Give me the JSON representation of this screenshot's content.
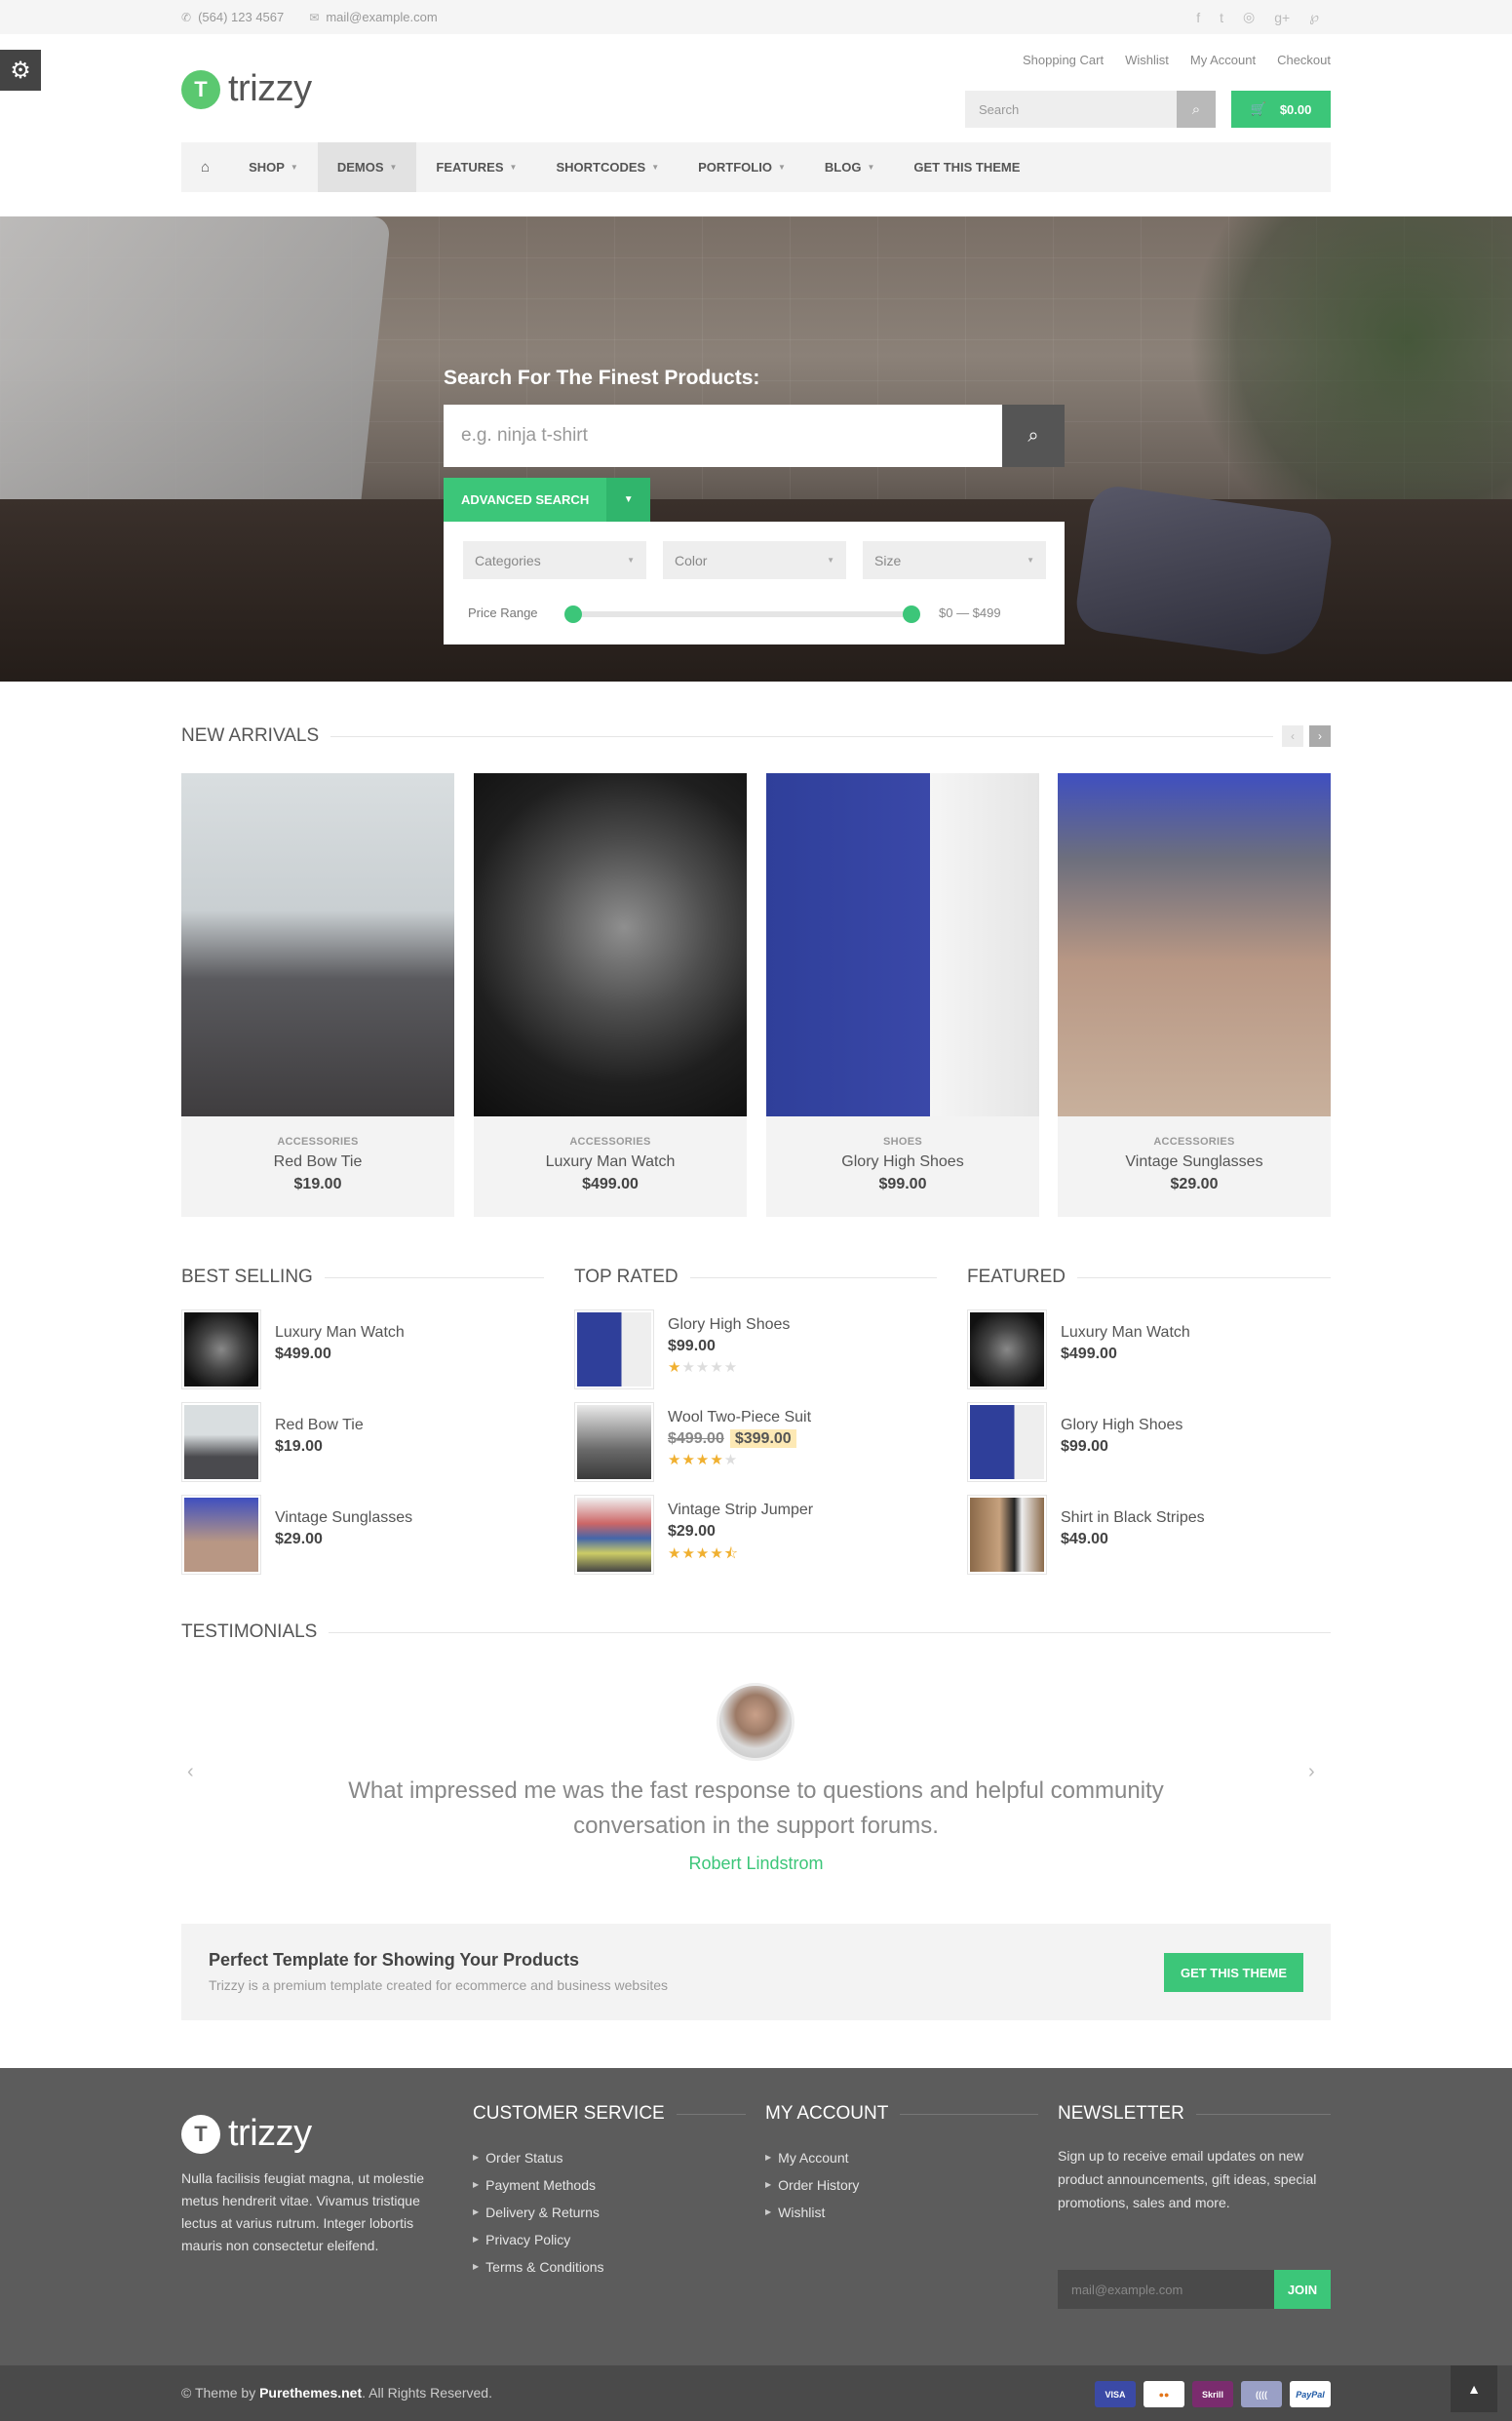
{
  "topbar": {
    "phone": "(564) 123 4567",
    "email": "mail@example.com",
    "social": [
      "facebook-icon",
      "twitter-icon",
      "dribbble-icon",
      "google-plus-icon",
      "pinterest-icon"
    ]
  },
  "header": {
    "logo_letter": "T",
    "logo_text": "trizzy",
    "links": [
      "Shopping Cart",
      "Wishlist",
      "My Account",
      "Checkout"
    ],
    "search_placeholder": "Search",
    "cart_total": "$0.00"
  },
  "nav": {
    "items": [
      {
        "label": "SHOP",
        "dropdown": true
      },
      {
        "label": "DEMOS",
        "dropdown": true,
        "active": true
      },
      {
        "label": "FEATURES",
        "dropdown": true
      },
      {
        "label": "SHORTCODES",
        "dropdown": true
      },
      {
        "label": "PORTFOLIO",
        "dropdown": true
      },
      {
        "label": "BLOG",
        "dropdown": true
      },
      {
        "label": "GET THIS THEME",
        "dropdown": false
      }
    ]
  },
  "hero": {
    "title": "Search For The Finest Products:",
    "search_placeholder": "e.g. ninja t-shirt",
    "advanced_label": "ADVANCED SEARCH",
    "filters": [
      "Categories",
      "Color",
      "Size"
    ],
    "price_label": "Price Range",
    "price_value": "$0 — $499",
    "price_min_fraction": 0,
    "price_max_fraction": 1
  },
  "new_arrivals": {
    "title": "NEW ARRIVALS",
    "products": [
      {
        "category": "ACCESSORIES",
        "name": "Red Bow Tie",
        "price": "$19.00",
        "image": "tie"
      },
      {
        "category": "ACCESSORIES",
        "name": "Luxury Man Watch",
        "price": "$499.00",
        "image": "watch"
      },
      {
        "category": "SHOES",
        "name": "Glory High Shoes",
        "price": "$99.00",
        "image": "shoes"
      },
      {
        "category": "ACCESSORIES",
        "name": "Vintage Sunglasses",
        "price": "$29.00",
        "image": "glasses"
      }
    ]
  },
  "best_selling": {
    "title": "BEST SELLING",
    "items": [
      {
        "name": "Luxury Man Watch",
        "price": "$499.00",
        "thumb": "watch"
      },
      {
        "name": "Red Bow Tie",
        "price": "$19.00",
        "thumb": "tie"
      },
      {
        "name": "Vintage Sunglasses",
        "price": "$29.00",
        "thumb": "glasses"
      }
    ]
  },
  "top_rated": {
    "title": "TOP RATED",
    "items": [
      {
        "name": "Glory High Shoes",
        "price": "$99.00",
        "rating": 1,
        "thumb": "shoes"
      },
      {
        "name": "Wool Two-Piece Suit",
        "old_price": "$499.00",
        "price": "$399.00",
        "rating": 4,
        "thumb": "suit"
      },
      {
        "name": "Vintage Strip Jumper",
        "price": "$29.00",
        "rating": 4.5,
        "thumb": "jumper"
      }
    ]
  },
  "featured": {
    "title": "FEATURED",
    "items": [
      {
        "name": "Luxury Man Watch",
        "price": "$499.00",
        "thumb": "watch"
      },
      {
        "name": "Glory High Shoes",
        "price": "$99.00",
        "thumb": "shoes"
      },
      {
        "name": "Shirt in Black Stripes",
        "price": "$49.00",
        "thumb": "stripes"
      }
    ]
  },
  "testimonials": {
    "title": "TESTIMONIALS",
    "quote": "What impressed me was the fast response to questions and helpful community conversation in the support forums.",
    "author": "Robert Lindstrom"
  },
  "cta": {
    "title": "Perfect Template for Showing Your Products",
    "text": "Trizzy is a premium template created for ecommerce and business websites",
    "button": "GET THIS THEME"
  },
  "footer": {
    "logo_text": "trizzy",
    "about": "Nulla facilisis feugiat magna, ut molestie metus hendrerit vitae. Vivamus tristique lectus at varius rutrum. Integer lobortis mauris non consectetur eleifend.",
    "customer_service": {
      "title": "CUSTOMER SERVICE",
      "links": [
        "Order Status",
        "Payment Methods",
        "Delivery & Returns",
        "Privacy Policy",
        "Terms & Conditions"
      ]
    },
    "my_account": {
      "title": "MY ACCOUNT",
      "links": [
        "My Account",
        "Order History",
        "Wishlist"
      ]
    },
    "newsletter": {
      "title": "NEWSLETTER",
      "text": "Sign up to receive email updates on new product announcements, gift ideas, special promotions, sales and more.",
      "placeholder": "mail@example.com",
      "button": "JOIN"
    },
    "copyright_prefix": "© Theme by ",
    "copyright_brand": "Purethemes.net",
    "copyright_suffix": ". All Rights Reserved.",
    "payments": [
      "VISA",
      "MC",
      "Skrill",
      "((((",
      "PayPal"
    ]
  },
  "colors": {
    "accent": "#3cc679",
    "footer_bg": "#5c5c5c",
    "bottom_bar": "#4a4a4a"
  }
}
